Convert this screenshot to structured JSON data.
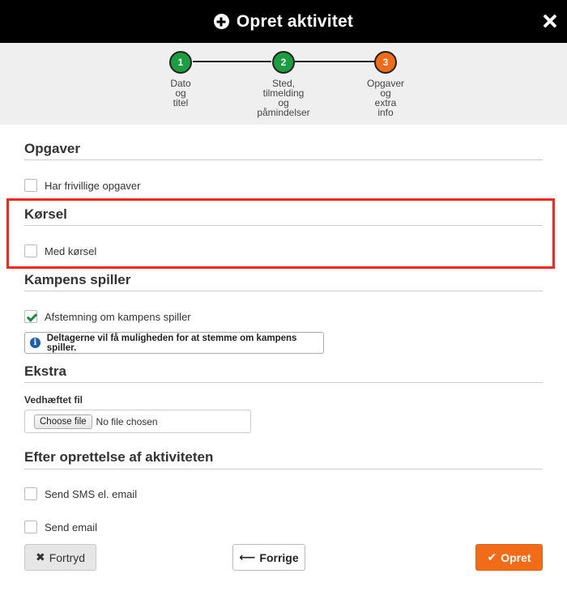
{
  "header": {
    "title": "Opret aktivitet",
    "icon": "plus-circle-icon",
    "close_icon": "close-icon"
  },
  "stepper": {
    "steps": [
      {
        "number": "1",
        "label_lines": [
          "Dato",
          "og",
          "titel"
        ],
        "color": "#1a9e3f"
      },
      {
        "number": "2",
        "label_lines": [
          "Sted,",
          "tilmelding",
          "og",
          "påmindelser"
        ],
        "color": "#1a9e3f"
      },
      {
        "number": "3",
        "label_lines": [
          "Opgaver",
          "og",
          "extra",
          "info"
        ],
        "color": "#f26c17"
      }
    ]
  },
  "sections": {
    "opgaver": {
      "title": "Opgaver",
      "checkbox_label": "Har frivillige opgaver",
      "checked": false
    },
    "korsel": {
      "title": "Kørsel",
      "checkbox_label": "Med kørsel",
      "checked": false
    },
    "kampens_spiller": {
      "title": "Kampens spiller",
      "checkbox_label": "Afstemning om kampens spiller",
      "checked": true,
      "info_text": "Deltagerne vil få muligheden for at stemme om kampens spiller."
    },
    "ekstra": {
      "title": "Ekstra",
      "file_label": "Vedhæftet fil",
      "choose_file": "Choose file",
      "no_file": "No file chosen"
    },
    "efter": {
      "title": "Efter oprettelse af aktiviteten",
      "sms_label": "Send SMS el. email",
      "sms_checked": false,
      "email_label": "Send email",
      "email_checked": false
    }
  },
  "buttons": {
    "cancel": {
      "label": "Fortryd",
      "icon": "x-icon"
    },
    "prev": {
      "label": "Forrige",
      "icon": "arrow-left-icon"
    },
    "create": {
      "label": "Opret",
      "icon": "check-icon"
    }
  },
  "colors": {
    "accent_orange": "#f26c17",
    "step_green": "#1a9e3f",
    "highlight_red": "#f0291a",
    "info_blue": "#1d5fa8"
  }
}
